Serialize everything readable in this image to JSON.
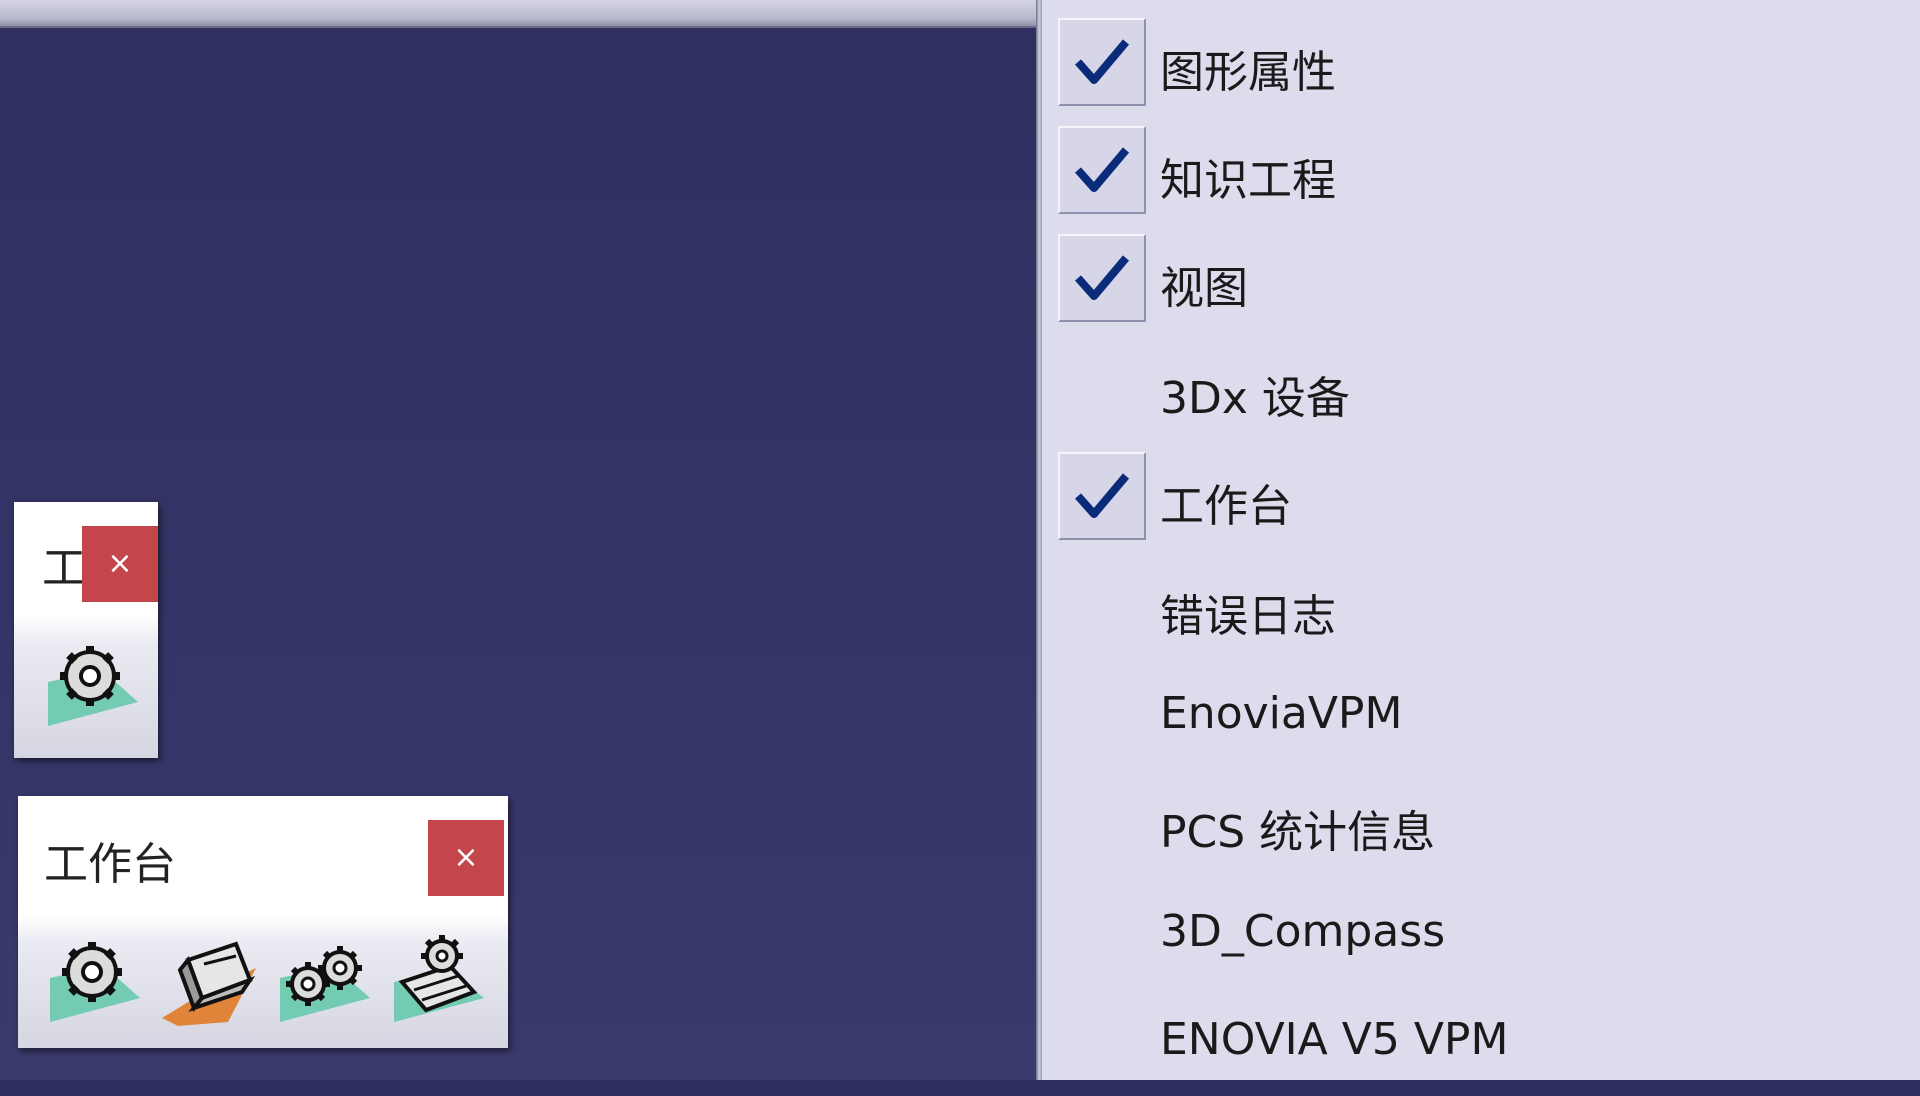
{
  "toolbar_small": {
    "title": "工",
    "close": "×"
  },
  "toolbar_large": {
    "title": "工作台",
    "close": "×"
  },
  "menu": {
    "items": [
      {
        "label": "图形属性",
        "checked": true
      },
      {
        "label": "知识工程",
        "checked": true
      },
      {
        "label": "视图",
        "checked": true
      },
      {
        "label": "3Dx 设备",
        "checked": false
      },
      {
        "label": "工作台",
        "checked": true
      },
      {
        "label": "错误日志",
        "checked": false
      },
      {
        "label": "EnoviaVPM",
        "checked": false
      },
      {
        "label": "PCS 统计信息",
        "checked": false
      },
      {
        "label": "3D_Compass",
        "checked": false
      },
      {
        "label": "ENOVIA V5 VPM",
        "checked": false
      }
    ]
  },
  "icons": {
    "toolbar_small": [
      "gear-tool-icon"
    ],
    "toolbar_large": [
      "gear-tool-icon",
      "sketch-tool-icon",
      "double-gear-tool-icon",
      "assembly-tool-icon"
    ]
  },
  "colors": {
    "viewport": "#343466",
    "close_button": "#c4454a",
    "check_mark": "#0a2a7a",
    "menu_background": "#dcdcec"
  }
}
